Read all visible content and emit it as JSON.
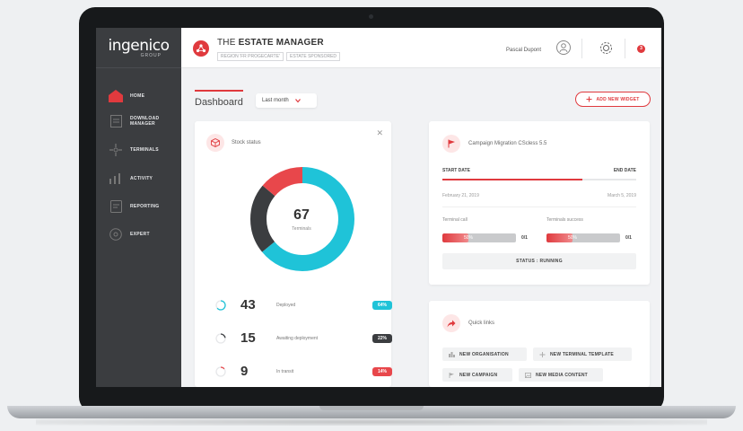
{
  "brand": {
    "name": "ingenico",
    "sub": "GROUP"
  },
  "header": {
    "title_prefix": "THE ",
    "title_bold": "ESTATE MANAGER",
    "tags": [
      "REGION 'FR PROGECARTE'",
      "ESTATE SPONSORED"
    ],
    "user_name": "Pascal Dupont",
    "notification_count": "3"
  },
  "sidebar": {
    "items": [
      {
        "label": "HOME",
        "icon": "home-icon",
        "active": true
      },
      {
        "label": "DOWNLOAD MANAGER",
        "icon": "download-icon"
      },
      {
        "label": "TERMINALS",
        "icon": "terminals-icon"
      },
      {
        "label": "ACTIVITY",
        "icon": "activity-icon"
      },
      {
        "label": "REPORTING",
        "icon": "reporting-icon"
      },
      {
        "label": "EXPERT",
        "icon": "expert-icon"
      }
    ]
  },
  "dashboard": {
    "title": "Dashboard",
    "range_label": "Last month",
    "add_widget_label": "ADD NEW WIDGET"
  },
  "stock": {
    "title": "Stock status",
    "total": "67",
    "total_label": "Terminals",
    "rows": [
      {
        "value": "43",
        "label": "Deployed",
        "pct": "64%",
        "color": "#1fc3d8"
      },
      {
        "value": "15",
        "label": "Awaiting deployment",
        "pct": "22%",
        "color": "#3b3d40"
      },
      {
        "value": "9",
        "label": "In transit",
        "pct": "14%",
        "color": "#e8474b"
      }
    ],
    "donut_fractions": [
      0.64,
      0.22,
      0.14
    ]
  },
  "campaign": {
    "title": "Campaign Migration CScless 5.5",
    "start_label": "START DATE",
    "end_label": "END DATE",
    "start_date": "February 21, 2019",
    "end_date": "March 5, 2019",
    "progress": 0.72,
    "metric1_label": "Terminal call",
    "metric1_pct": "50%",
    "metric1_value": 0.5,
    "metric1_frac": "0/1",
    "metric2_label": "Terminals success",
    "metric2_pct": "50%",
    "metric2_value": 0.5,
    "metric2_frac": "0/1",
    "status": "STATUS : RUNNING"
  },
  "quick_links": {
    "title": "Quick links",
    "items": [
      {
        "label": "NEW ORGANISATION",
        "icon": "organisation-icon"
      },
      {
        "label": "NEW TERMINAL TEMPLATE",
        "icon": "plus-icon"
      },
      {
        "label": "NEW CAMPAIGN",
        "icon": "flag-icon"
      },
      {
        "label": "NEW MEDIA CONTENT",
        "icon": "media-icon"
      }
    ]
  },
  "colors": {
    "accent": "#e03a3e",
    "teal": "#1fc3d8",
    "dark": "#3b3d40"
  }
}
